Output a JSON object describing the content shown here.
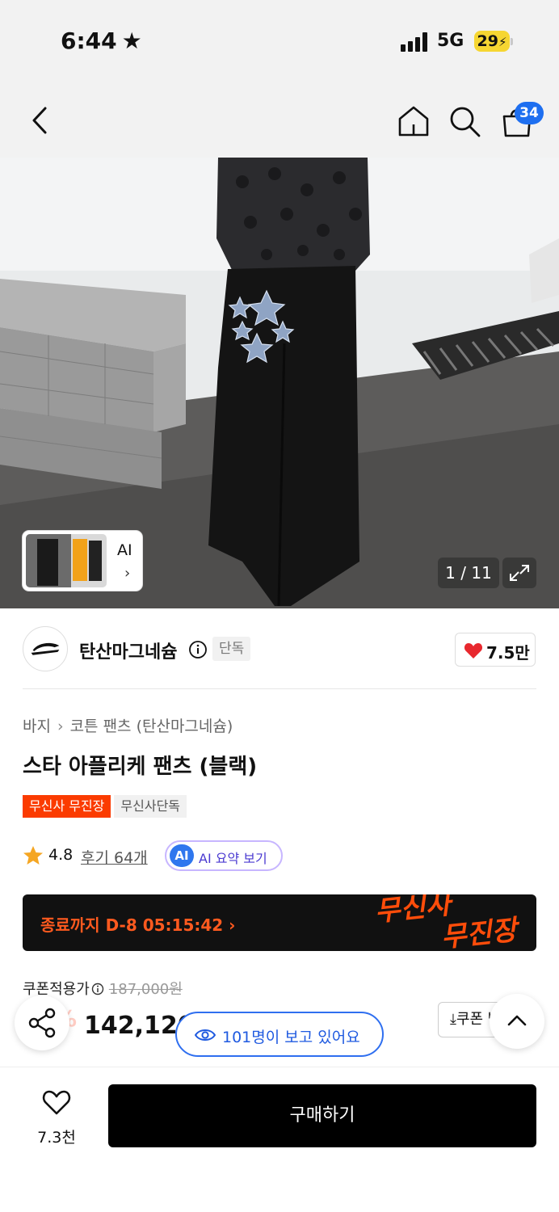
{
  "status_bar": {
    "time": "6:44",
    "network": "5G",
    "battery": "29"
  },
  "nav": {
    "cart_count": "34"
  },
  "gallery": {
    "ai_label": "AI",
    "page_indicator": "1 / 11"
  },
  "brand": {
    "name": "탄산마그네슘",
    "exclusive_tag": "단독",
    "likes": "7.5만"
  },
  "product": {
    "breadcrumb": [
      "바지",
      "코튼 팬츠 (탄산마그네슘)"
    ],
    "title": "스타 아플리케 팬츠 (블랙)",
    "tags": [
      "무신사 무진장",
      "무신사단독"
    ],
    "rating": "4.8",
    "reviews": "후기 64개",
    "ai_summary_badge": "AI",
    "ai_summary_label": "AI 요약 보기"
  },
  "promo": {
    "countdown": "종료까지 D-8 05:15:42 ›",
    "promo_line1": "무신사",
    "promo_line2": "무진장"
  },
  "price": {
    "coupon_label": "쿠폰적용가",
    "original": "187,000원",
    "discount": "24%",
    "final": "142,120원",
    "coupon_button": "⤓쿠폰 받기"
  },
  "viewers": {
    "text": "101명이 보고 있어요"
  },
  "bottom": {
    "favorites": "7.3천",
    "buy_label": "구매하기"
  },
  "colors": {
    "accent_blue": "#1e6ff0",
    "sale_orange": "#fb3b00",
    "like_red": "#e8282e"
  }
}
